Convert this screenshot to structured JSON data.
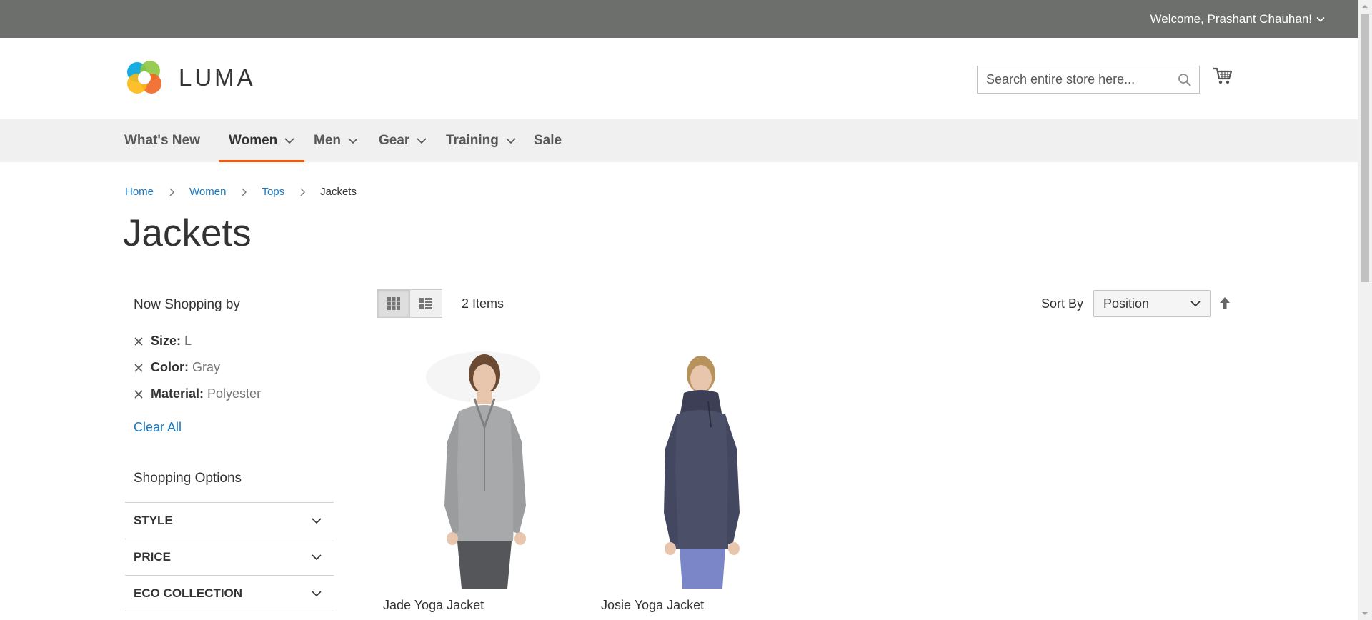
{
  "topbar": {
    "welcome": "Welcome, Prashant Chauhan!"
  },
  "header": {
    "logo_text": "LUMA",
    "search_placeholder": "Search entire store here..."
  },
  "nav": {
    "items": [
      {
        "label": "What's New",
        "dropdown": false
      },
      {
        "label": "Women",
        "dropdown": true,
        "active": true
      },
      {
        "label": "Men",
        "dropdown": true
      },
      {
        "label": "Gear",
        "dropdown": true
      },
      {
        "label": "Training",
        "dropdown": true
      },
      {
        "label": "Sale",
        "dropdown": false
      }
    ]
  },
  "breadcrumb": [
    "Home",
    "Women",
    "Tops",
    "Jackets"
  ],
  "page_title": "Jackets",
  "sidebar": {
    "title": "Now Shopping by",
    "filters": [
      {
        "label": "Size:",
        "value": "L"
      },
      {
        "label": "Color:",
        "value": "Gray"
      },
      {
        "label": "Material:",
        "value": "Polyester"
      }
    ],
    "clear_all": "Clear All",
    "options_title": "Shopping Options",
    "options": [
      "Style",
      "Price",
      "Eco Collection"
    ]
  },
  "toolbar": {
    "amount": "2 Items",
    "sort_label": "Sort By",
    "sort_value": "Position"
  },
  "products": [
    {
      "name": "Jade Yoga Jacket",
      "color": "#a8a9ab"
    },
    {
      "name": "Josie Yoga Jacket",
      "color": "#4b5068"
    }
  ],
  "colors": {
    "accent": "#ff5501",
    "link": "#1979c3",
    "topbar": "#6d6f6c"
  }
}
